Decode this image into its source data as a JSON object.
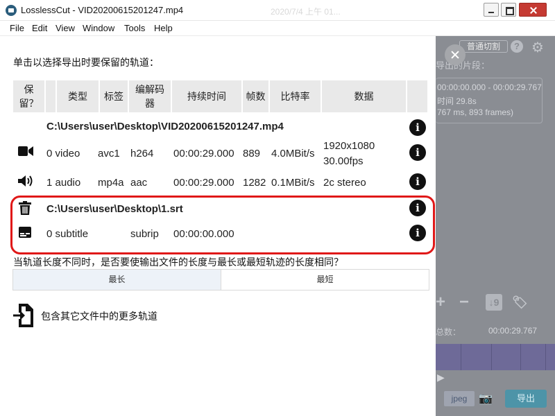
{
  "window": {
    "title": "LosslessCut - VID20200615201247.mp4",
    "ghost_title": "2020/7/4 上午 01...",
    "menu": [
      "File",
      "Edit",
      "View",
      "Window",
      "Tools",
      "Help"
    ]
  },
  "background_app": {
    "mode_button": "普通切割",
    "help_glyph": "?",
    "segments_title": "导出的片段：",
    "segment_range": "00:00:00.000 - 00:00:29.767",
    "segment_duration": "时间 29.8s",
    "segment_frames": "767 ms, 893 frames)",
    "total_label": "总数：",
    "total_value": "00:00:29.767",
    "jpeg_label": "jpeg",
    "export_label": "导出"
  },
  "dialog": {
    "instruction": "单击以选择导出时要保留的轨道：",
    "headers": {
      "keep": "保留？",
      "type": "类型",
      "tag": "标签",
      "codec": "编解码器",
      "duration": "持续时间",
      "frames": "帧数",
      "bitrate": "比特率",
      "data": "数据"
    },
    "files": [
      {
        "path": "C:\\Users\\user\\Desktop\\VID20200615201247.mp4",
        "tracks": [
          {
            "icon": "video-camera-icon",
            "type": "0 video",
            "tag": "avc1",
            "codec": "h264",
            "duration": "00:00:29.000",
            "frames": "889",
            "bitrate": "4.0MBit/s",
            "data_line1": "1920x1080",
            "data_line2": "30.00fps"
          },
          {
            "icon": "volume-icon",
            "type": "1 audio",
            "tag": "mp4a",
            "codec": "aac",
            "duration": "00:00:29.000",
            "frames": "1282",
            "bitrate": "0.1MBit/s",
            "data_line1": "2c stereo",
            "data_line2": ""
          }
        ]
      },
      {
        "path": "C:\\Users\\user\\Desktop\\1.srt",
        "tracks": [
          {
            "icon": "subtitles-icon",
            "type": "0 subtitle",
            "tag": "",
            "codec": "subrip",
            "duration": "00:00:00.000",
            "frames": "",
            "bitrate": "",
            "data_line1": "",
            "data_line2": ""
          }
        ]
      }
    ],
    "info_glyph": "i",
    "length_question": "当轨道长度不同时，是否要使输出文件的长度与最长或最短轨迹的长度相同？",
    "length_options": {
      "longest": "最长",
      "shortest": "最短"
    },
    "selected_length_option": "longest",
    "include_more": "包含其它文件中的更多轨道"
  },
  "colors": {
    "highlight_border": "#e01818",
    "header_bg": "#e9e9e9",
    "overlay_bg": "#8a8d93",
    "export_button": "#4d94a8"
  }
}
